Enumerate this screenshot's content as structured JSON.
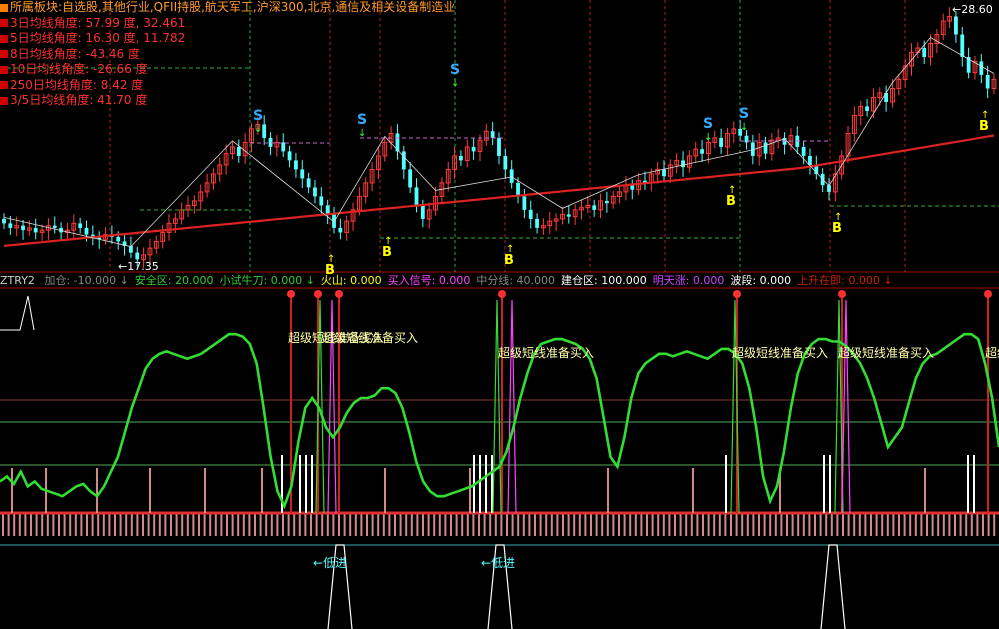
{
  "header": {
    "sector_label": "所属板块:",
    "sector_value": "自选股,其他行业,QFII持股,航天军工,沪深300,北京,通信及相关设备制造业",
    "angle_rows": [
      {
        "name": "3日均线角度:",
        "value": "57.99",
        "unit": "度",
        "extra": "32.461"
      },
      {
        "name": "5日均线角度:",
        "value": "16.30",
        "unit": "度",
        "extra": "11.782"
      },
      {
        "name": "8日均线角度:",
        "value": "-43.46",
        "unit": "度",
        "extra": ""
      },
      {
        "name": "10日均线角度:",
        "value": "-26.66",
        "unit": "度",
        "extra": ""
      },
      {
        "name": "250日均线角度:",
        "value": "8.42",
        "unit": "度",
        "extra": ""
      },
      {
        "name": "3/5日均线角度:",
        "value": "41.70",
        "unit": "度",
        "extra": ""
      }
    ]
  },
  "indicator_bar": {
    "name": "ZTRY2",
    "items": [
      {
        "label": "加仓:",
        "value": "-10.000",
        "arrow": "↓",
        "color": "#888888"
      },
      {
        "label": "安全区:",
        "value": "20.000",
        "arrow": "",
        "color": "#33cc33"
      },
      {
        "label": "小试牛刀:",
        "value": "0.000",
        "arrow": "↓",
        "color": "#33cc33"
      },
      {
        "label": "火山:",
        "value": "0.000",
        "arrow": "",
        "color": "#ffff00"
      },
      {
        "label": "买入信号:",
        "value": "0.000",
        "arrow": "",
        "color": "#ff44ff"
      },
      {
        "label": "中分线:",
        "value": "40.000",
        "arrow": "",
        "color": "#888888"
      },
      {
        "label": "建仓区:",
        "value": "100.000",
        "arrow": "",
        "color": "#ffffff"
      },
      {
        "label": "明天涨:",
        "value": "0.000",
        "arrow": "",
        "color": "#cc44ff"
      },
      {
        "label": "波段:",
        "value": "0.000",
        "arrow": "",
        "color": "#ffffff"
      },
      {
        "label": "上升在即:",
        "value": "0.000",
        "arrow": "↓",
        "color": "#cc2200"
      }
    ]
  },
  "colors": {
    "up": "#ff3b3b",
    "down": "#54ffff",
    "ma_long": "#dd2222",
    "trend_line": "#dddddd",
    "oscillator": "#33dd33",
    "signal_s": "#33aaff",
    "signal_b": "#ffff00",
    "dashed_green": "#33aa33",
    "dashed_purple": "#cc66cc"
  },
  "chart_data": [
    {
      "type": "candlestick",
      "title": "",
      "price_range": [
        17.35,
        28.6
      ],
      "high_label": "28.60",
      "low_label": "17.35",
      "closes": [
        19.2,
        19.0,
        19.1,
        18.9,
        19.0,
        18.8,
        18.9,
        19.1,
        19.0,
        18.8,
        18.9,
        19.2,
        19.0,
        18.7,
        18.6,
        18.5,
        18.7,
        18.6,
        18.4,
        18.2,
        17.9,
        17.6,
        17.8,
        18.1,
        18.4,
        18.8,
        19.2,
        19.4,
        19.8,
        20.0,
        20.2,
        20.6,
        21.0,
        21.4,
        21.8,
        22.3,
        22.6,
        22.2,
        22.8,
        23.4,
        23.6,
        23.0,
        22.6,
        22.8,
        22.4,
        22.0,
        21.6,
        21.2,
        20.8,
        20.4,
        20.0,
        19.6,
        19.0,
        18.8,
        19.3,
        19.8,
        20.4,
        21.0,
        21.6,
        22.2,
        22.8,
        23.2,
        22.4,
        21.6,
        20.8,
        20.0,
        19.4,
        19.8,
        20.4,
        21.0,
        21.6,
        22.2,
        22.0,
        22.6,
        22.4,
        22.9,
        23.3,
        23.0,
        22.2,
        21.6,
        21.0,
        20.4,
        19.8,
        19.4,
        19.0,
        19.1,
        19.3,
        19.4,
        19.6,
        19.5,
        19.8,
        19.9,
        20.0,
        19.8,
        20.2,
        20.1,
        20.4,
        20.6,
        20.9,
        20.7,
        21.1,
        21.0,
        21.4,
        21.6,
        21.3,
        21.8,
        22.0,
        21.7,
        22.2,
        22.5,
        22.3,
        22.8,
        23.0,
        22.6,
        23.2,
        23.4,
        23.1,
        22.8,
        22.2,
        22.8,
        22.3,
        22.9,
        23.0,
        22.7,
        23.1,
        22.6,
        22.2,
        21.8,
        21.4,
        20.9,
        20.6,
        21.4,
        22.2,
        23.2,
        24.0,
        24.4,
        24.2,
        24.8,
        25.0,
        24.6,
        25.2,
        25.6,
        26.2,
        26.8,
        27.0,
        26.6,
        27.2,
        27.6,
        28.2,
        28.4,
        27.6,
        26.6,
        25.9,
        26.4,
        25.8,
        25.2,
        25.6
      ],
      "s_signals": [
        "S",
        "S",
        "S",
        "S",
        "S"
      ],
      "b_signals": [
        "B",
        "B",
        "B",
        "B",
        "B",
        "B"
      ],
      "marks": {
        "down_arrow": "↓",
        "up_arrow": "↑",
        "high_arrow": "←",
        "low_arrow": "←"
      }
    },
    {
      "type": "line",
      "title": "ZTRY2",
      "ylim": [
        -10,
        100
      ],
      "series": [
        {
          "name": "波段",
          "values": [
            22,
            24,
            21,
            26,
            20,
            22,
            19,
            18,
            17,
            16,
            18,
            20,
            21,
            18,
            16,
            20,
            26,
            32,
            42,
            52,
            60,
            68,
            72,
            74,
            75,
            74,
            73,
            72,
            73,
            74,
            76,
            78,
            80,
            82,
            82,
            81,
            78,
            70,
            52,
            32,
            18,
            12,
            20,
            38,
            52,
            56,
            52,
            44,
            40,
            44,
            50,
            54,
            56,
            56,
            57,
            60,
            60,
            58,
            52,
            42,
            30,
            22,
            18,
            16,
            16,
            17,
            18,
            19,
            20,
            22,
            24,
            26,
            28,
            34,
            44,
            56,
            66,
            74,
            78,
            79,
            80,
            80,
            79,
            78,
            76,
            72,
            64,
            48,
            32,
            28,
            40,
            56,
            66,
            70,
            72,
            74,
            74,
            73,
            74,
            75,
            74,
            73,
            72,
            74,
            76,
            76,
            74,
            70,
            60,
            44,
            24,
            14,
            20,
            34,
            52,
            66,
            74,
            78,
            80,
            80,
            79,
            79,
            77,
            74,
            70,
            64,
            56,
            46,
            36,
            40,
            44,
            54,
            64,
            70,
            73,
            74,
            76,
            78,
            80,
            82,
            82,
            80,
            70,
            56,
            36
          ]
        }
      ],
      "annotation": "超级短线准备买入",
      "low_entry_label": "←低进",
      "low_entry_label_2": "←低进"
    }
  ]
}
